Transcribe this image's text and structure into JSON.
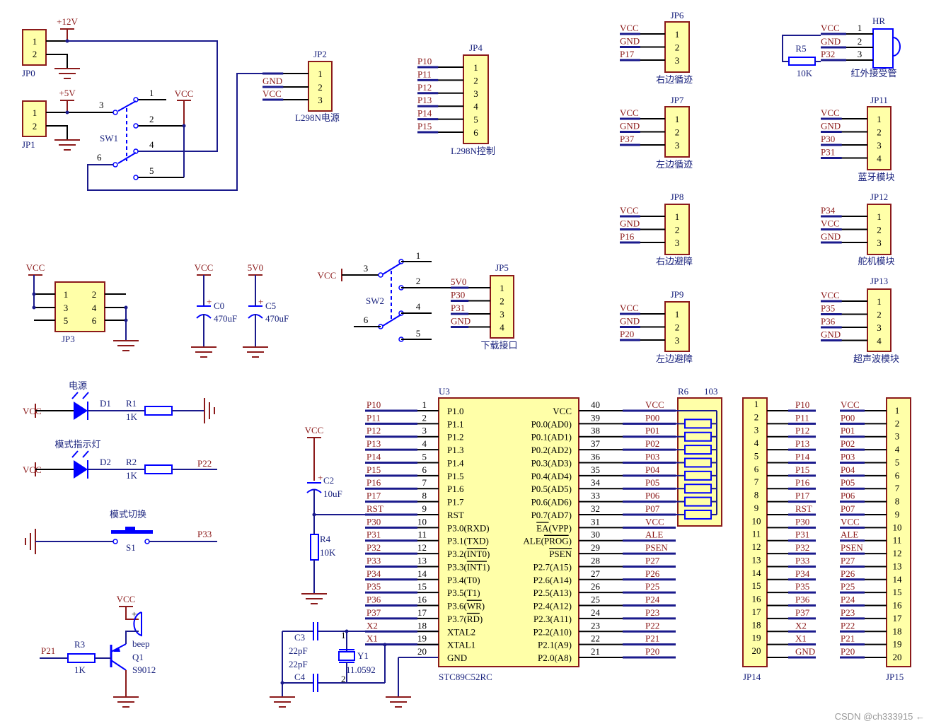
{
  "watermark": "CSDN @ch333915 ←",
  "colors": {
    "net_label": "#8b1a1a",
    "wire": "#1a1a8c",
    "pin": "#000000",
    "component": "#0000ff",
    "body_fill": "#ffffa8",
    "body_border": "#8b1a1a"
  },
  "power": {
    "p12v": "+12V",
    "p5v": "+5V",
    "vcc": "VCC",
    "v5v0": "5V0"
  },
  "jp0": {
    "ref": "JP0",
    "pins": [
      "1",
      "2"
    ]
  },
  "jp1": {
    "ref": "JP1",
    "pins": [
      "1",
      "2"
    ]
  },
  "sw1": {
    "ref": "SW1",
    "pins": [
      "1",
      "2",
      "3",
      "4",
      "5",
      "6"
    ]
  },
  "jp2": {
    "ref": "JP2",
    "label": "L298N电源",
    "pins": [
      "1",
      "2",
      "3"
    ],
    "nets": [
      "",
      "GND",
      "VCC"
    ]
  },
  "jp4": {
    "ref": "JP4",
    "label": "L298N控制",
    "pins": [
      "1",
      "2",
      "3",
      "4",
      "5",
      "6"
    ],
    "nets": [
      "P10",
      "P11",
      "P12",
      "P13",
      "P14",
      "P15"
    ]
  },
  "jp6": {
    "ref": "JP6",
    "label": "右边循迹",
    "pins": [
      "1",
      "2",
      "3"
    ],
    "nets": [
      "VCC",
      "GND",
      "P17"
    ]
  },
  "jp7": {
    "ref": "JP7",
    "label": "左边循迹",
    "pins": [
      "1",
      "2",
      "3"
    ],
    "nets": [
      "VCC",
      "GND",
      "P37"
    ]
  },
  "jp8": {
    "ref": "JP8",
    "label": "右边避障",
    "pins": [
      "1",
      "2",
      "3"
    ],
    "nets": [
      "VCC",
      "GND",
      "P16"
    ]
  },
  "jp9": {
    "ref": "JP9",
    "label": "左边避障",
    "pins": [
      "1",
      "2",
      "3"
    ],
    "nets": [
      "VCC",
      "GND",
      "P20"
    ]
  },
  "hr": {
    "ref": "HR",
    "label": "红外接受管",
    "pins": [
      "1",
      "2",
      "3"
    ],
    "nets": [
      "VCC",
      "GND",
      "P32"
    ],
    "r_ref": "R5",
    "r_value": "10K"
  },
  "jp11": {
    "ref": "JP11",
    "label": "蓝牙模块",
    "pins": [
      "1",
      "2",
      "3",
      "4"
    ],
    "nets": [
      "VCC",
      "GND",
      "P30",
      "P31"
    ]
  },
  "jp12": {
    "ref": "JP12",
    "label": "舵机模块",
    "pins": [
      "1",
      "2",
      "3"
    ],
    "nets": [
      "P34",
      "VCC",
      "GND"
    ]
  },
  "jp13": {
    "ref": "JP13",
    "label": "超声波模块",
    "pins": [
      "1",
      "2",
      "3",
      "4"
    ],
    "nets": [
      "VCC",
      "P35",
      "P36",
      "GND"
    ]
  },
  "jp3": {
    "ref": "JP3",
    "pins": [
      "1",
      "2",
      "3",
      "4",
      "5",
      "6"
    ],
    "net": "VCC"
  },
  "c0": {
    "ref": "C0",
    "value": "470uF",
    "net": "VCC",
    "plus": "+"
  },
  "c5": {
    "ref": "C5",
    "value": "470uF",
    "net": "5V0",
    "plus": "+"
  },
  "sw2": {
    "ref": "SW2",
    "pins": [
      "1",
      "2",
      "3",
      "4",
      "5",
      "6"
    ],
    "net": "VCC"
  },
  "jp5": {
    "ref": "JP5",
    "label": "下载接口",
    "pins": [
      "1",
      "2",
      "3",
      "4"
    ],
    "nets": [
      "5V0",
      "P30",
      "P31",
      "GND"
    ]
  },
  "led1": {
    "title": "电源",
    "net": "VCC",
    "d_ref": "D1",
    "r_ref": "R1",
    "r_value": "1K"
  },
  "led2": {
    "title": "模式指示灯",
    "net": "VCC",
    "d_ref": "D2",
    "r_ref": "R2",
    "r_value": "1K",
    "out_net": "P22"
  },
  "s1": {
    "title": "模式切换",
    "ref": "S1",
    "out_net": "P33"
  },
  "beep": {
    "net": "VCC",
    "plus": "+",
    "buzzer": "beep",
    "q_ref": "Q1",
    "q_part": "S9012",
    "r_ref": "R3",
    "r_value": "1K",
    "in_net": "P21"
  },
  "reset": {
    "net": "VCC",
    "c_ref": "C2",
    "c_value": "10uF",
    "plus": "+",
    "r_ref": "R4",
    "r_value": "10K"
  },
  "crystal": {
    "c3_ref": "C3",
    "c3_value": "22pF",
    "c4_ref": "C4",
    "c4_value": "22pF",
    "y_ref": "Y1",
    "y_value": "11.0592",
    "pin1": "1",
    "pin2": "2"
  },
  "u3": {
    "ref": "U3",
    "part": "STC89C52RC",
    "left": [
      {
        "pin": "1",
        "net": "P10",
        "name": [
          "P1.0"
        ]
      },
      {
        "pin": "2",
        "net": "P11",
        "name": [
          "P1.1"
        ]
      },
      {
        "pin": "3",
        "net": "P12",
        "name": [
          "P1.2"
        ]
      },
      {
        "pin": "4",
        "net": "P13",
        "name": [
          "P1.3"
        ]
      },
      {
        "pin": "5",
        "net": "P14",
        "name": [
          "P1.4"
        ]
      },
      {
        "pin": "6",
        "net": "P15",
        "name": [
          "P1.5"
        ]
      },
      {
        "pin": "7",
        "net": "P16",
        "name": [
          "P1.6"
        ]
      },
      {
        "pin": "8",
        "net": "P17",
        "name": [
          "P1.7"
        ]
      },
      {
        "pin": "9",
        "net": "RST",
        "name": [
          "RST"
        ]
      },
      {
        "pin": "10",
        "net": "P30",
        "name": [
          "P3.0(RXD)"
        ]
      },
      {
        "pin": "11",
        "net": "P31",
        "name": [
          "P3.1(TXD)"
        ]
      },
      {
        "pin": "12",
        "net": "P32",
        "name": [
          "P3.2(",
          "INT0",
          ")"
        ]
      },
      {
        "pin": "13",
        "net": "P33",
        "name": [
          "P3.3(",
          "INT1",
          ")"
        ]
      },
      {
        "pin": "14",
        "net": "P34",
        "name": [
          "P3.4(T0)"
        ]
      },
      {
        "pin": "15",
        "net": "P35",
        "name": [
          "P3.5(T1)"
        ]
      },
      {
        "pin": "16",
        "net": "P36",
        "name": [
          "P3.6(",
          "WR",
          ")"
        ]
      },
      {
        "pin": "17",
        "net": "P37",
        "name": [
          "P3.7(",
          "RD",
          ")"
        ]
      },
      {
        "pin": "18",
        "net": "X2",
        "name": [
          "XTAL2"
        ]
      },
      {
        "pin": "19",
        "net": "X1",
        "name": [
          "XTAL1"
        ]
      },
      {
        "pin": "20",
        "net": "",
        "name": [
          "GND"
        ]
      }
    ],
    "right": [
      {
        "pin": "40",
        "net": "VCC",
        "name": [
          "VCC"
        ]
      },
      {
        "pin": "39",
        "net": "P00",
        "name": [
          "P0.0(AD0)"
        ]
      },
      {
        "pin": "38",
        "net": "P01",
        "name": [
          "P0.1(AD1)"
        ]
      },
      {
        "pin": "37",
        "net": "P02",
        "name": [
          "P0.2(AD2)"
        ]
      },
      {
        "pin": "36",
        "net": "P03",
        "name": [
          "P0.3(AD3)"
        ]
      },
      {
        "pin": "35",
        "net": "P04",
        "name": [
          "P0.4(AD4)"
        ]
      },
      {
        "pin": "34",
        "net": "P05",
        "name": [
          "P0.5(AD5)"
        ]
      },
      {
        "pin": "33",
        "net": "P06",
        "name": [
          "P0.6(AD6)"
        ]
      },
      {
        "pin": "32",
        "net": "P07",
        "name": [
          "P0.7(AD7)"
        ]
      },
      {
        "pin": "31",
        "net": "VCC",
        "name": [
          "",
          "EA",
          "(VPP)"
        ]
      },
      {
        "pin": "30",
        "net": "ALE",
        "name": [
          "ALE(",
          "PROG",
          ")"
        ]
      },
      {
        "pin": "29",
        "net": "PSEN",
        "name": [
          "",
          "PSEN",
          ""
        ]
      },
      {
        "pin": "28",
        "net": "P27",
        "name": [
          "P2.7(A15)"
        ]
      },
      {
        "pin": "27",
        "net": "P26",
        "name": [
          "P2.6(A14)"
        ]
      },
      {
        "pin": "26",
        "net": "P25",
        "name": [
          "P2.5(A13)"
        ]
      },
      {
        "pin": "25",
        "net": "P24",
        "name": [
          "P2.4(A12)"
        ]
      },
      {
        "pin": "24",
        "net": "P23",
        "name": [
          "P2.3(A11)"
        ]
      },
      {
        "pin": "23",
        "net": "P22",
        "name": [
          "P2.2(A10)"
        ]
      },
      {
        "pin": "22",
        "net": "P21",
        "name": [
          "P2.1(A9)"
        ]
      },
      {
        "pin": "21",
        "net": "P20",
        "name": [
          "P2.0(A8)"
        ]
      }
    ]
  },
  "r6": {
    "ref": "R6",
    "value": "103"
  },
  "jp14": {
    "ref": "JP14",
    "pins": [
      "1",
      "2",
      "3",
      "4",
      "5",
      "6",
      "7",
      "8",
      "9",
      "10",
      "11",
      "12",
      "13",
      "14",
      "15",
      "16",
      "17",
      "18",
      "19",
      "20"
    ],
    "nets": [
      "P10",
      "P11",
      "P12",
      "P13",
      "P14",
      "P15",
      "P16",
      "P17",
      "RST",
      "P30",
      "P31",
      "P32",
      "P33",
      "P34",
      "P35",
      "P36",
      "P37",
      "X2",
      "X1",
      "GND"
    ]
  },
  "jp15": {
    "ref": "JP15",
    "pins": [
      "1",
      "2",
      "3",
      "4",
      "5",
      "6",
      "7",
      "8",
      "9",
      "10",
      "11",
      "12",
      "13",
      "14",
      "15",
      "16",
      "17",
      "18",
      "19",
      "20"
    ],
    "nets": [
      "VCC",
      "P00",
      "P01",
      "P02",
      "P03",
      "P04",
      "P05",
      "P06",
      "P07",
      "VCC",
      "ALE",
      "PSEN",
      "P27",
      "P26",
      "P25",
      "P24",
      "P23",
      "P22",
      "P21",
      "P20"
    ]
  }
}
